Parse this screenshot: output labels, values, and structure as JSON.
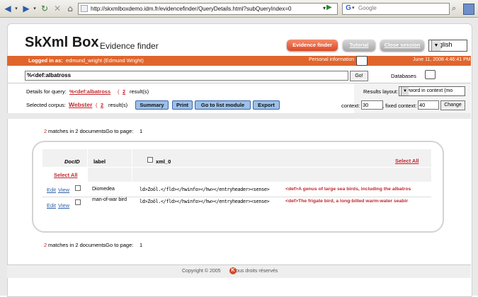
{
  "browser": {
    "url": "http://skxmlboxdemo.idm.fr/evidencefinder/QueryDetails.html?subQueryIndex=0",
    "search_placeholder": "Google"
  },
  "header": {
    "logo": "SkXml Box",
    "subtitle": "Evidence finder",
    "btn_evidence": "Evidence finder",
    "btn_tutorial": "Tutorial",
    "btn_close": "Close session",
    "language": "English"
  },
  "userbar": {
    "logged_label": "Logged in as:",
    "user": "edmund_wright (Edmund Wright)",
    "personal_info": "Personal information",
    "date": "June 11, 2008 4:46:41 PM"
  },
  "query": {
    "value": "%<def:albatross",
    "go": "Go!",
    "databases": "Databases"
  },
  "details": {
    "label": "Details for query:",
    "query": "%<def:albatross",
    "open": "(",
    "count": "2",
    "results": "result(s)",
    "corpus_label": "Selected corpus:",
    "corpus": "Webster",
    "corpus_open": "(",
    "corpus_count": "2",
    "corpus_results": "result(s)",
    "btn_summary": "Summary",
    "btn_print": "Print",
    "btn_list": "Go to list module",
    "btn_export": "Export"
  },
  "layout": {
    "label": "Results layout:",
    "value": "Keyword in context (mo",
    "context_label": "context:",
    "context": "30",
    "fixed_label": ", fixed context:",
    "fixed": "40",
    "change": "Change"
  },
  "matches": {
    "count": "2",
    "text": "matches in 2 documents",
    "goto": ". Go to page:",
    "page": "1"
  },
  "table": {
    "col_docid": "DocID",
    "col_label": "label",
    "col_xml": "xml_0",
    "select_all": "Select All",
    "rows": [
      {
        "edit": "Edit",
        "view": "View",
        "label": "Diomedea",
        "context": "ld>Zoöl.</fld></hwinfo></hw></entryheader><sense>",
        "hit": "<def>A genus of large sea birds, including the albatros"
      },
      {
        "edit": "Edit",
        "view": "View",
        "label": "man-of-war bird",
        "context": "ld>Zoöl.</fld></hwinfo></hw></entryheader><sense>",
        "hit": "<def>The frigate bird, a long-billed warm-water seabir"
      }
    ]
  },
  "footer": {
    "copyright": "Copyright © 2005",
    "rights": "Tous droits réservés"
  }
}
